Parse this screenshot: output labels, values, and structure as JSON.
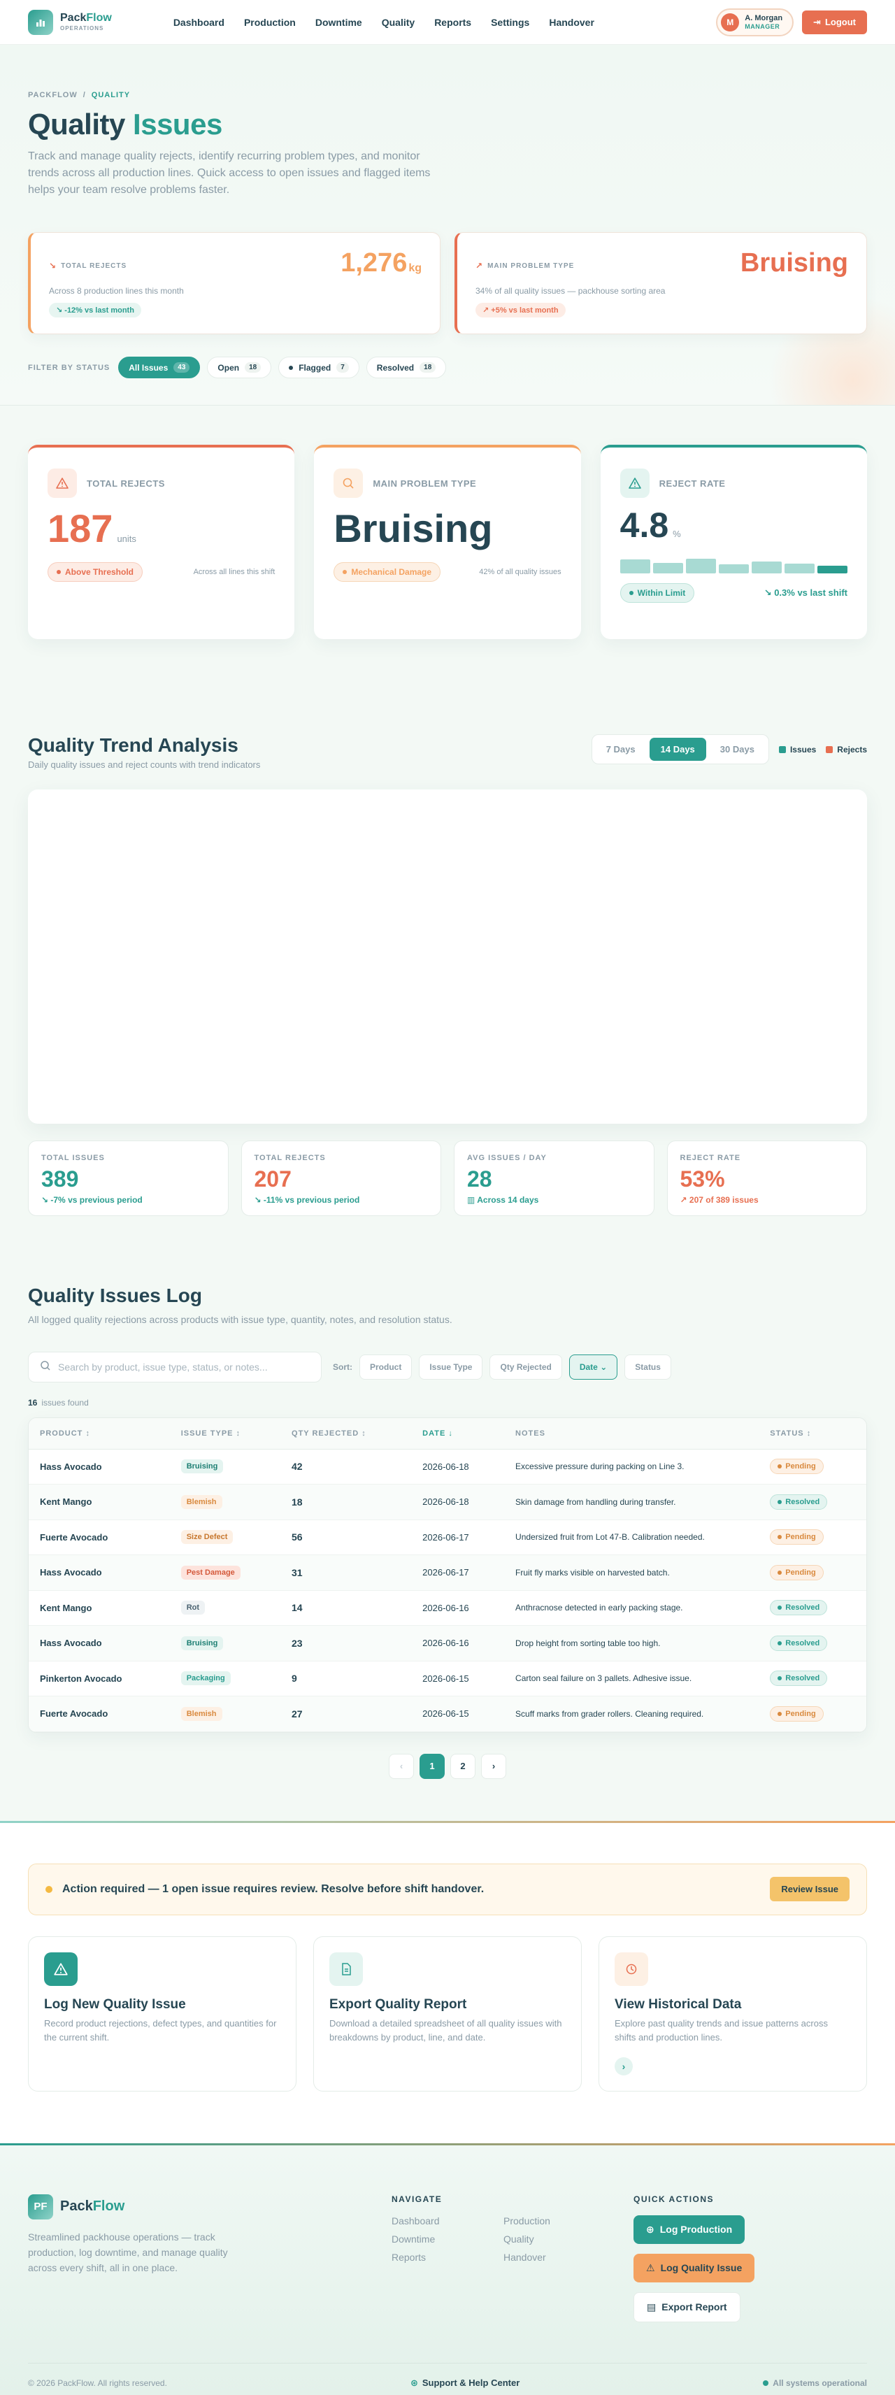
{
  "nav": {
    "brand": "Pack",
    "brand_accent": "Flow",
    "brand_sub": "OPERATIONS",
    "links": [
      "Dashboard",
      "Production",
      "Downtime",
      "Quality",
      "Reports",
      "Settings",
      "Handover"
    ],
    "user_initial": "M",
    "user_name": "A. Morgan",
    "user_role": "MANAGER",
    "logout": "Logout"
  },
  "hero": {
    "crumb_root": "PACKFLOW",
    "crumb_sep": "/",
    "crumb_current": "QUALITY",
    "title": "Quality",
    "title_accent": "Issues",
    "description": "Track and manage quality rejects, identify recurring problem types, and monitor trends across all production lines. Quick access to open issues and flagged items helps your team resolve problems faster.",
    "card1": {
      "label": "TOTAL REJECTS",
      "value": "1,276",
      "unit": "kg",
      "desc": "Across 8 production lines this month",
      "chip": "-12% vs last month"
    },
    "card2": {
      "label": "MAIN PROBLEM TYPE",
      "value": "Bruising",
      "desc": "34% of all quality issues — packhouse sorting area",
      "chip": "+5% vs last month"
    },
    "filter_label": "FILTER BY STATUS",
    "filters": [
      {
        "label": "All Issues",
        "count": "43"
      },
      {
        "label": "Open",
        "count": "18"
      },
      {
        "label": "Flagged",
        "count": "7"
      },
      {
        "label": "Resolved",
        "count": "18"
      }
    ]
  },
  "metrics": {
    "m1": {
      "label": "TOTAL REJECTS",
      "value": "187",
      "unit": "units",
      "tag": "Above Threshold",
      "note": "Across all lines this shift"
    },
    "m2": {
      "label": "MAIN PROBLEM TYPE",
      "value": "Bruising",
      "tag": "Mechanical Damage",
      "note": "42% of all quality issues"
    },
    "m3": {
      "label": "REJECT RATE",
      "value": "4.8",
      "unit": "%",
      "tag": "Within Limit",
      "trend": "0.3% vs last shift",
      "bars": [
        0.7,
        0.55,
        0.75,
        0.45,
        0.6,
        0.5,
        0.4
      ]
    }
  },
  "trend": {
    "title": "Quality Trend Analysis",
    "subtitle": "Daily quality issues and reject counts with trend indicators",
    "ranges": [
      "7 Days",
      "14 Days",
      "30 Days"
    ],
    "legend_issues": "Issues",
    "legend_rejects": "Rejects",
    "stats": [
      {
        "label": "TOTAL ISSUES",
        "value": "389",
        "note": "-7% vs previous period"
      },
      {
        "label": "TOTAL REJECTS",
        "value": "207",
        "note": "-11% vs previous period"
      },
      {
        "label": "AVG ISSUES / DAY",
        "value": "28",
        "note": "Across 14 days"
      },
      {
        "label": "REJECT RATE",
        "value": "53%",
        "note": "207 of 389 issues"
      }
    ]
  },
  "log": {
    "title": "Quality Issues Log",
    "subtitle": "All logged quality rejections across products with issue type, quantity, notes, and resolution status.",
    "search_placeholder": "Search by product, issue type, status, or notes...",
    "sort_label": "Sort:",
    "sorts": [
      "Product",
      "Issue Type",
      "Qty Rejected",
      "Date",
      "Status"
    ],
    "found_count": "16",
    "found_label": "issues found",
    "columns": [
      "PRODUCT",
      "ISSUE TYPE",
      "QTY REJECTED",
      "DATE",
      "NOTES",
      "STATUS"
    ],
    "rows": [
      {
        "product": "Hass Avocado",
        "type": "Bruising",
        "qty": "42",
        "date": "2026-06-18",
        "notes": "Excessive pressure during packing on Line 3.",
        "status": "Pending"
      },
      {
        "product": "Kent Mango",
        "type": "Blemish",
        "qty": "18",
        "date": "2026-06-18",
        "notes": "Skin damage from handling during transfer.",
        "status": "Resolved"
      },
      {
        "product": "Fuerte Avocado",
        "type": "Size Defect",
        "qty": "56",
        "date": "2026-06-17",
        "notes": "Undersized fruit from Lot 47-B. Calibration needed.",
        "status": "Pending"
      },
      {
        "product": "Hass Avocado",
        "type": "Pest Damage",
        "qty": "31",
        "date": "2026-06-17",
        "notes": "Fruit fly marks visible on harvested batch.",
        "status": "Pending"
      },
      {
        "product": "Kent Mango",
        "type": "Rot",
        "qty": "14",
        "date": "2026-06-16",
        "notes": "Anthracnose detected in early packing stage.",
        "status": "Resolved"
      },
      {
        "product": "Hass Avocado",
        "type": "Bruising",
        "qty": "23",
        "date": "2026-06-16",
        "notes": "Drop height from sorting table too high.",
        "status": "Resolved"
      },
      {
        "product": "Pinkerton Avocado",
        "type": "Packaging",
        "qty": "9",
        "date": "2026-06-15",
        "notes": "Carton seal failure on 3 pallets. Adhesive issue.",
        "status": "Resolved"
      },
      {
        "product": "Fuerte Avocado",
        "type": "Blemish",
        "qty": "27",
        "date": "2026-06-15",
        "notes": "Scuff marks from grader rollers. Cleaning required.",
        "status": "Pending"
      }
    ],
    "pages": [
      "1",
      "2"
    ]
  },
  "actions": {
    "alert": "Action required — 1 open issue requires review. Resolve before shift handover.",
    "alert_btn": "Review Issue",
    "cards": [
      {
        "title": "Log New Quality Issue",
        "desc": "Record product rejections, defect types, and quantities for the current shift."
      },
      {
        "title": "Export Quality Report",
        "desc": "Download a detailed spreadsheet of all quality issues with breakdowns by product, line, and date."
      },
      {
        "title": "View Historical Data",
        "desc": "Explore past quality trends and issue patterns across shifts and production lines."
      }
    ]
  },
  "footer": {
    "logo": "PF",
    "brand": "Pack",
    "brand_accent": "Flow",
    "desc": "Streamlined packhouse operations — track production, log downtime, and manage quality across every shift, all in one place.",
    "nav_heading": "NAVIGATE",
    "nav_links": [
      "Dashboard",
      "Production",
      "Downtime",
      "Quality",
      "Reports",
      "Handover"
    ],
    "quick_heading": "QUICK ACTIONS",
    "quick": [
      "Log Production",
      "Log Quality Issue",
      "Export Report"
    ],
    "copyright": "© 2026 PackFlow. All rights reserved.",
    "support": "Support & Help Center",
    "system": "All systems operational"
  },
  "colors": {
    "teal": "#2a9d8f",
    "orange": "#f4a261",
    "red": "#e76f51",
    "navy": "#264653"
  },
  "type_styles": {
    "Bruising": "#e4f4f0|#1e7f73",
    "Blemish": "#fdf0e4|#d98a3f",
    "Size Defect": "#fdf0e4|#c7772e",
    "Pest Damage": "#fde3dc|#d45a3c",
    "Rot": "#eef2f4|#4a6270",
    "Packaging": "#e4f4f0|#2a9d8f"
  }
}
